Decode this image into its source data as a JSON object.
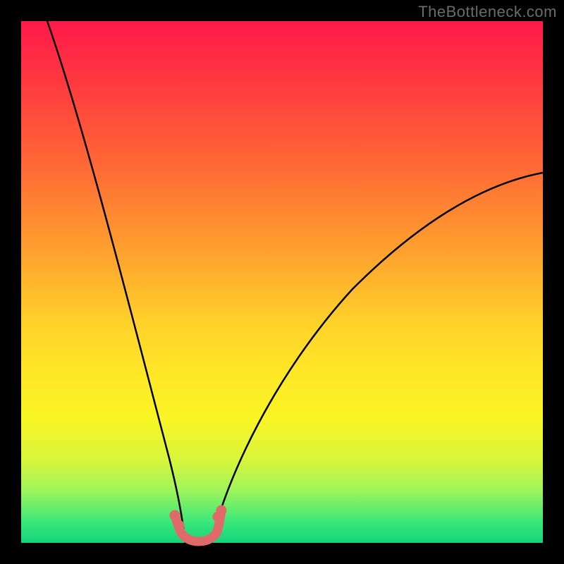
{
  "watermark": "TheBottleneck.com",
  "chart_data": {
    "type": "line",
    "title": "",
    "xlabel": "",
    "ylabel": "",
    "xlim": [
      0,
      100
    ],
    "ylim": [
      0,
      100
    ],
    "background_gradient": {
      "top_color": "#ff1a4b",
      "mid_color": "#ffe826",
      "bottom_color": "#14d47a"
    },
    "series": [
      {
        "name": "left-curve",
        "stroke": "#000000",
        "x": [
          5,
          8,
          12,
          16,
          20,
          24,
          27,
          29,
          30.5,
          31.5
        ],
        "y": [
          100,
          87,
          72,
          56,
          40,
          25,
          13,
          6,
          2,
          0
        ]
      },
      {
        "name": "right-curve",
        "stroke": "#000000",
        "x": [
          36.5,
          38,
          41,
          46,
          54,
          64,
          76,
          88,
          100
        ],
        "y": [
          0,
          2,
          8,
          18,
          32,
          45,
          56,
          64,
          71
        ]
      },
      {
        "name": "bottom-connector",
        "stroke": "#e06a6a",
        "x": [
          29.5,
          30.2,
          31,
          32,
          33.2,
          34.5,
          35.8,
          36.8,
          37.6,
          38.3
        ],
        "y": [
          5.3,
          3.4,
          1.9,
          0.9,
          0.5,
          0.9,
          1.9,
          3.4,
          5.3,
          6.2
        ]
      }
    ],
    "markers": [
      {
        "name": "left-marker-top",
        "x": 29.5,
        "y": 5.3,
        "color": "#e06a6a"
      },
      {
        "name": "left-marker-bot",
        "x": 30.2,
        "y": 3.4,
        "color": "#e06a6a"
      },
      {
        "name": "right-marker-top",
        "x": 38.3,
        "y": 6.2,
        "color": "#e06a6a"
      },
      {
        "name": "right-marker-bot",
        "x": 37.6,
        "y": 5.0,
        "color": "#e06a6a"
      }
    ]
  }
}
